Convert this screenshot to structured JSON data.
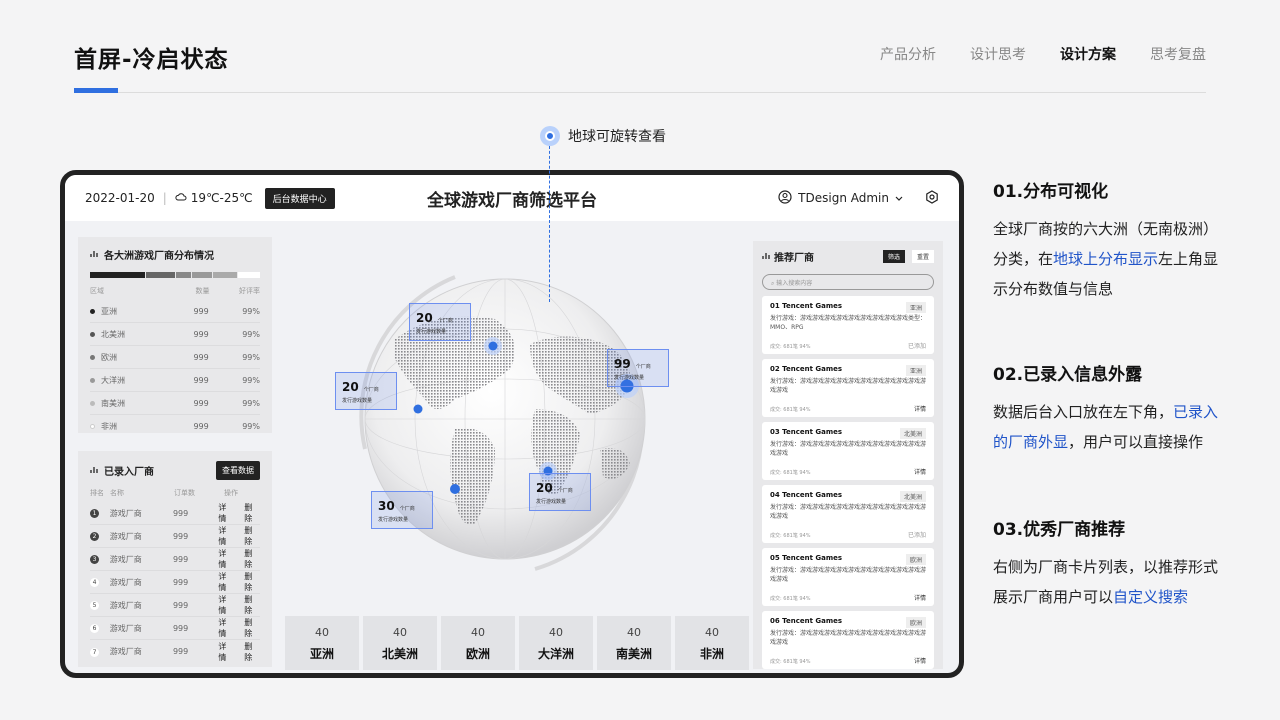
{
  "page_title": "首屏-冷启状态",
  "nav": [
    "产品分析",
    "设计思考",
    "设计方案",
    "思考复盘"
  ],
  "nav_active": 2,
  "hint": "地球可旋转查看",
  "dashboard": {
    "date": "2022-01-20",
    "weather": "19℃-25℃",
    "backend_button": "后台数据中心",
    "title": "全球游戏厂商筛选平台",
    "user": "TDesign Admin",
    "distribution": {
      "title": "各大洲游戏厂商分布情况",
      "columns": [
        "区域",
        "数量",
        "好评率"
      ],
      "rows": [
        {
          "region": "亚洲",
          "count": "999",
          "rate": "99%",
          "color": "#222222"
        },
        {
          "region": "北美洲",
          "count": "999",
          "rate": "99%",
          "color": "#555555"
        },
        {
          "region": "欧洲",
          "count": "999",
          "rate": "99%",
          "color": "#777777"
        },
        {
          "region": "大洋洲",
          "count": "999",
          "rate": "99%",
          "color": "#999999"
        },
        {
          "region": "南美洲",
          "count": "999",
          "rate": "99%",
          "color": "#bbbbbb"
        },
        {
          "region": "非洲",
          "count": "999",
          "rate": "99%",
          "color": "#ffffff"
        }
      ]
    },
    "recorded": {
      "title": "已录入厂商",
      "button": "查看数据",
      "columns": [
        "排名",
        "名称",
        "订单数",
        "操作"
      ],
      "rows": [
        {
          "rank": "1",
          "name": "游戏厂商",
          "orders": "999"
        },
        {
          "rank": "2",
          "name": "游戏厂商",
          "orders": "999"
        },
        {
          "rank": "3",
          "name": "游戏厂商",
          "orders": "999"
        },
        {
          "rank": "4",
          "name": "游戏厂商",
          "orders": "999"
        },
        {
          "rank": "5",
          "name": "游戏厂商",
          "orders": "999"
        },
        {
          "rank": "6",
          "name": "游戏厂商",
          "orders": "999"
        },
        {
          "rank": "7",
          "name": "游戏厂商",
          "orders": "999"
        }
      ],
      "detail": "详情",
      "delete": "删除"
    },
    "globe_labels": [
      {
        "num": "20",
        "unit": "个厂商",
        "desc": "发行游戏数量"
      },
      {
        "num": "20",
        "unit": "个厂商",
        "desc": "发行游戏数量"
      },
      {
        "num": "99",
        "unit": "个厂商",
        "desc": "发行游戏数量"
      },
      {
        "num": "30",
        "unit": "个厂商",
        "desc": "发行游戏数量"
      },
      {
        "num": "20",
        "unit": "个厂商",
        "desc": "发行游戏数量"
      }
    ],
    "continents": [
      {
        "value": "40",
        "name": "亚洲"
      },
      {
        "value": "40",
        "name": "北美洲"
      },
      {
        "value": "40",
        "name": "欧洲"
      },
      {
        "value": "40",
        "name": "大洋洲"
      },
      {
        "value": "40",
        "name": "南美洲"
      },
      {
        "value": "40",
        "name": "非洲"
      }
    ],
    "recommend": {
      "title": "推荐厂商",
      "filter": "筛选",
      "reset": "重置",
      "search_placeholder": "输入搜索内容",
      "cards": [
        {
          "title": "01 Tencent Games",
          "tag": "亚洲",
          "desc": "发行游戏：游戏游戏游戏游戏游戏游戏游戏游戏游戏类型：MMO、RPG",
          "foot": "成交: 681笔   94%",
          "action": "已添加"
        },
        {
          "title": "02 Tencent Games",
          "tag": "亚洲",
          "desc": "发行游戏：游戏游戏游戏游戏游戏游戏游戏游戏游戏游戏游戏游戏",
          "foot": "成交: 681笔   94%",
          "action": "详情"
        },
        {
          "title": "03 Tencent Games",
          "tag": "北美洲",
          "desc": "发行游戏：游戏游戏游戏游戏游戏游戏游戏游戏游戏游戏游戏游戏",
          "foot": "成交: 681笔   94%",
          "action": "详情"
        },
        {
          "title": "04 Tencent Games",
          "tag": "北美洲",
          "desc": "发行游戏：游戏游戏游戏游戏游戏游戏游戏游戏游戏游戏游戏游戏",
          "foot": "成交: 681笔   94%",
          "action": "已添加"
        },
        {
          "title": "05 Tencent Games",
          "tag": "欧洲",
          "desc": "发行游戏：游戏游戏游戏游戏游戏游戏游戏游戏游戏游戏游戏游戏",
          "foot": "成交: 681笔   94%",
          "action": "详情"
        },
        {
          "title": "06 Tencent Games",
          "tag": "欧洲",
          "desc": "发行游戏：游戏游戏游戏游戏游戏游戏游戏游戏游戏游戏游戏游戏",
          "foot": "成交: 681笔   94%",
          "action": "详情"
        }
      ]
    }
  },
  "notes": [
    {
      "title": "01.分布可视化",
      "pre": "全球厂商按的六大洲（无南极洲）分类，在",
      "hl": "地球上分布显示",
      "post": "左上角显示分布数值与信息"
    },
    {
      "title": "02.已录入信息外露",
      "pre": "数据后台入口放在左下角，",
      "hl": "已录入的厂商外显",
      "post": "，用户可以直接操作"
    },
    {
      "title": "03.优秀厂商推荐",
      "pre": "右侧为厂商卡片列表，以推荐形式展示厂商用户可以",
      "hl": "自定义搜索",
      "post": ""
    }
  ]
}
